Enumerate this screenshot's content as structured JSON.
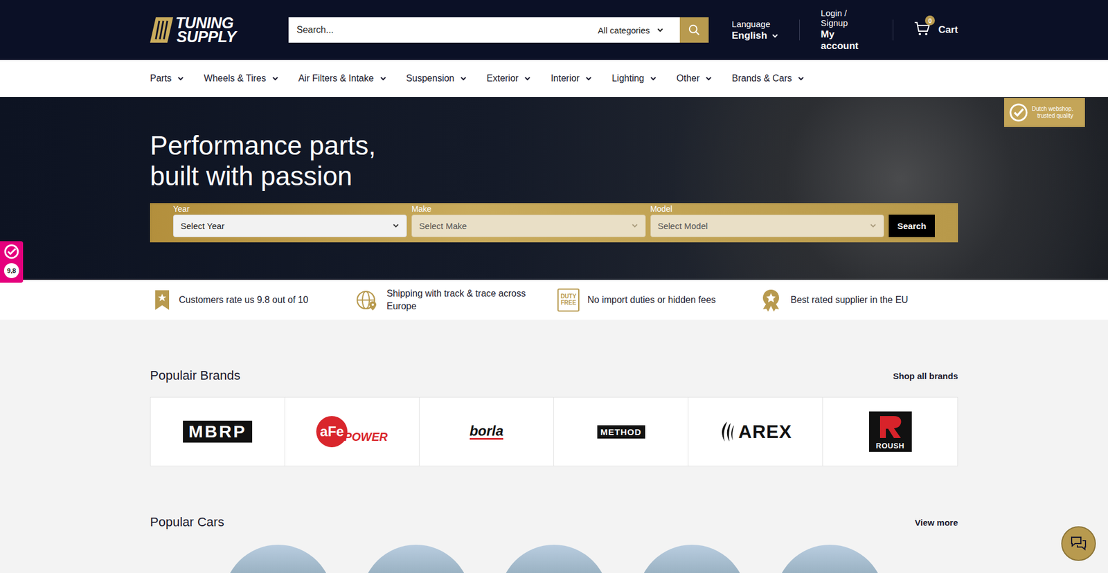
{
  "header": {
    "logo": {
      "line1": "TUNING",
      "line2": "SUPPLY"
    },
    "search": {
      "placeholder": "Search...",
      "category": "All categories"
    },
    "language": {
      "label": "Language",
      "value": "English"
    },
    "account": {
      "label": "Login / Signup",
      "value": "My account"
    },
    "cart": {
      "count": "0",
      "label": "Cart"
    }
  },
  "nav": [
    "Parts",
    "Wheels & Tires",
    "Air Filters & Intake",
    "Suspension",
    "Exterior",
    "Interior",
    "Lighting",
    "Other",
    "Brands & Cars"
  ],
  "hero": {
    "title_lines": [
      "Performance parts,",
      "built with passion"
    ],
    "finder": {
      "fields": [
        {
          "label": "Year",
          "placeholder": "Select Year",
          "disabled": false
        },
        {
          "label": "Make",
          "placeholder": "Select Make",
          "disabled": true
        },
        {
          "label": "Model",
          "placeholder": "Select Model",
          "disabled": true
        }
      ],
      "button": "Search"
    }
  },
  "trust_badge": {
    "lines": [
      "Dutch webshop.",
      "trusted quality"
    ]
  },
  "rating_widget": {
    "score": "9,8"
  },
  "features": [
    {
      "kind": "ribbon",
      "text": "Customers rate us 9.8 out of 10"
    },
    {
      "kind": "globe",
      "text": "Shipping with track & trace across Europe"
    },
    {
      "kind": "duty",
      "icon_text": [
        "DUTY",
        "FREE"
      ],
      "text": "No import duties or hidden fees"
    },
    {
      "kind": "award",
      "text": "Best rated supplier in the EU"
    }
  ],
  "brands": {
    "title": "Populair Brands",
    "link": "Shop all brands",
    "items": [
      {
        "kind": "box",
        "name": "MBRP"
      },
      {
        "kind": "afe",
        "name": "aFe",
        "sub": "POWER"
      },
      {
        "kind": "italic",
        "name": "borla"
      },
      {
        "kind": "plate",
        "name": "METHOD"
      },
      {
        "kind": "wide",
        "name": "AREX"
      },
      {
        "kind": "roush",
        "name": "ROUSH"
      }
    ]
  },
  "cars": {
    "title": "Popular Cars",
    "link": "View more",
    "items": [
      {
        "kind": "photo"
      },
      {
        "kind": "photo"
      },
      {
        "kind": "photo"
      },
      {
        "kind": "photo"
      },
      {
        "kind": "photo"
      }
    ]
  }
}
